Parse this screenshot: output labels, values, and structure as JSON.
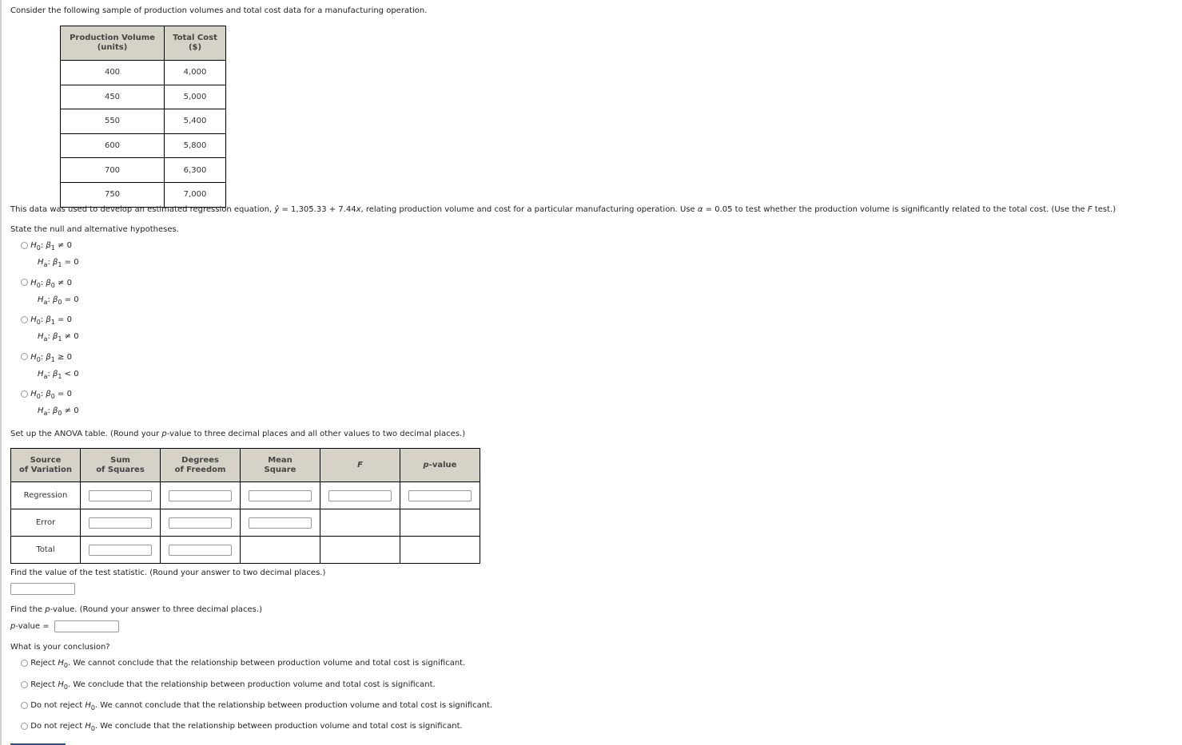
{
  "intro": "Consider the following sample of production volumes and total cost data for a manufacturing operation.",
  "data_table": {
    "headers": [
      [
        "Production Volume",
        "(units)"
      ],
      [
        "Total Cost",
        "($)"
      ]
    ],
    "rows": [
      [
        "400",
        "4,000"
      ],
      [
        "450",
        "5,000"
      ],
      [
        "550",
        "5,400"
      ],
      [
        "600",
        "5,800"
      ],
      [
        "700",
        "6,300"
      ],
      [
        "750",
        "7,000"
      ]
    ]
  },
  "regression_text": {
    "a": "This data was used to develop an estimated regression equation, ",
    "yhat": "ŷ",
    "b": " = 1,305.33 + 7.44",
    "x": "x",
    "c": ", relating production volume and cost for a particular manufacturing operation. Use ",
    "alpha": "α",
    "d": " = 0.05 to test whether the production volume is significantly related to the total cost. (Use the ",
    "F": "F",
    "e": " test.)"
  },
  "hypotheses_prompt": "State the null and alternative hypotheses.",
  "hypotheses": [
    {
      "h0": {
        "sub": "1",
        "op": " ≠ 0"
      },
      "ha": {
        "sub": "1",
        "op": " = 0"
      }
    },
    {
      "h0": {
        "sub": "0",
        "op": " ≠ 0"
      },
      "ha": {
        "sub": "0",
        "op": " = 0"
      }
    },
    {
      "h0": {
        "sub": "1",
        "op": " = 0"
      },
      "ha": {
        "sub": "1",
        "op": " ≠ 0"
      }
    },
    {
      "h0": {
        "sub": "1",
        "op": " ≥ 0"
      },
      "ha": {
        "sub": "1",
        "op": " < 0"
      }
    },
    {
      "h0": {
        "sub": "0",
        "op": " = 0"
      },
      "ha": {
        "sub": "0",
        "op": " ≠ 0"
      }
    }
  ],
  "symbols": {
    "H": "H",
    "h0sub": "0",
    "hasub": "a",
    "beta": "β",
    "colon": ":"
  },
  "anova_prompt": {
    "a": "Set up the ANOVA table. (Round your ",
    "p": "p",
    "b": "-value to three decimal places and all other values to two decimal places.)"
  },
  "anova": {
    "headers": [
      [
        "Source",
        "of Variation"
      ],
      [
        "Sum",
        "of Squares"
      ],
      [
        "Degrees",
        "of Freedom"
      ],
      [
        "Mean",
        "Square"
      ]
    ],
    "header_F": "F",
    "header_p": "p",
    "header_p_suffix": "-value",
    "rows": [
      "Regression",
      "Error",
      "Total"
    ]
  },
  "test_stat_prompt": "Find the value of the test statistic. (Round your answer to two decimal places.)",
  "pvalue_prompt": {
    "a": "Find the ",
    "p": "p",
    "b": "-value. (Round your answer to three decimal places.)"
  },
  "pvalue_label": {
    "p": "p",
    "b": "-value ="
  },
  "conclusion_prompt": "What is your conclusion?",
  "conclusions": [
    {
      "pre": "Reject ",
      "post": ". We cannot conclude that the relationship between production volume and total cost is significant."
    },
    {
      "pre": "Reject ",
      "post": ". We conclude that the relationship between production volume and total cost is significant."
    },
    {
      "pre": "Do not reject ",
      "post": ". We cannot conclude that the relationship between production volume and total cost is significant."
    },
    {
      "pre": "Do not reject ",
      "post": ". We conclude that the relationship between production volume and total cost is significant."
    }
  ],
  "colors": {
    "header_bg": "#d6d2c8",
    "link": "#2255aa"
  }
}
